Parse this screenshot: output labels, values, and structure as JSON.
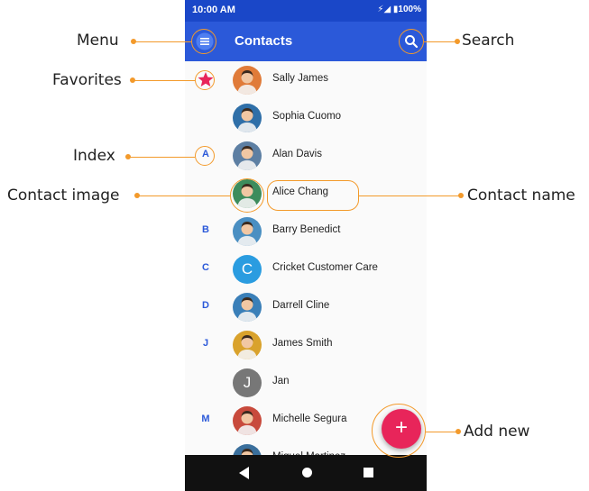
{
  "status_bar": {
    "time": "10:00 AM",
    "icons": "⚡◢ ▮100%"
  },
  "app_bar": {
    "title": "Contacts"
  },
  "colors": {
    "primary": "#2b59d9",
    "status": "#1a47c8",
    "fab": "#e8255a",
    "callout": "#f39a2b"
  },
  "contacts": [
    {
      "index": "",
      "favorite": true,
      "name": "Sally James",
      "avatar_color": "#e07b39",
      "initial": ""
    },
    {
      "index": "",
      "favorite": false,
      "name": "Sophia Cuomo",
      "avatar_color": "#2f6fa8",
      "initial": ""
    },
    {
      "index": "A",
      "favorite": false,
      "name": "Alan Davis",
      "avatar_color": "#5d7fa3",
      "initial": ""
    },
    {
      "index": "",
      "favorite": false,
      "name": "Alice Chang",
      "avatar_color": "#3d8c5c",
      "initial": ""
    },
    {
      "index": "B",
      "favorite": false,
      "name": "Barry Benedict",
      "avatar_color": "#4a8fc2",
      "initial": ""
    },
    {
      "index": "C",
      "favorite": false,
      "name": "Cricket Customer Care",
      "avatar_color": "#2a9ce0",
      "initial": "C"
    },
    {
      "index": "D",
      "favorite": false,
      "name": "Darrell Cline",
      "avatar_color": "#3a7fb8",
      "initial": ""
    },
    {
      "index": "J",
      "favorite": false,
      "name": "James Smith",
      "avatar_color": "#d9a22c",
      "initial": ""
    },
    {
      "index": "",
      "favorite": false,
      "name": "Jan",
      "avatar_color": "#777777",
      "initial": "J"
    },
    {
      "index": "M",
      "favorite": false,
      "name": "Michelle Segura",
      "avatar_color": "#c84a3c",
      "initial": ""
    },
    {
      "index": "",
      "favorite": false,
      "name": "Miguel Martinez",
      "avatar_color": "#3a6f9c",
      "initial": ""
    }
  ],
  "fab": {
    "label": "+"
  },
  "callouts": {
    "menu": "Menu",
    "favorites": "Favorites",
    "index": "Index",
    "contact_image": "Contact image",
    "search": "Search",
    "contact_name": "Contact name",
    "add_new": "Add new"
  },
  "icons": {
    "menu": "hamburger-menu-icon",
    "search": "magnifier-icon",
    "favorite": "star-icon",
    "back": "triangle-back-icon",
    "home": "circle-home-icon",
    "recent": "square-recents-icon"
  }
}
